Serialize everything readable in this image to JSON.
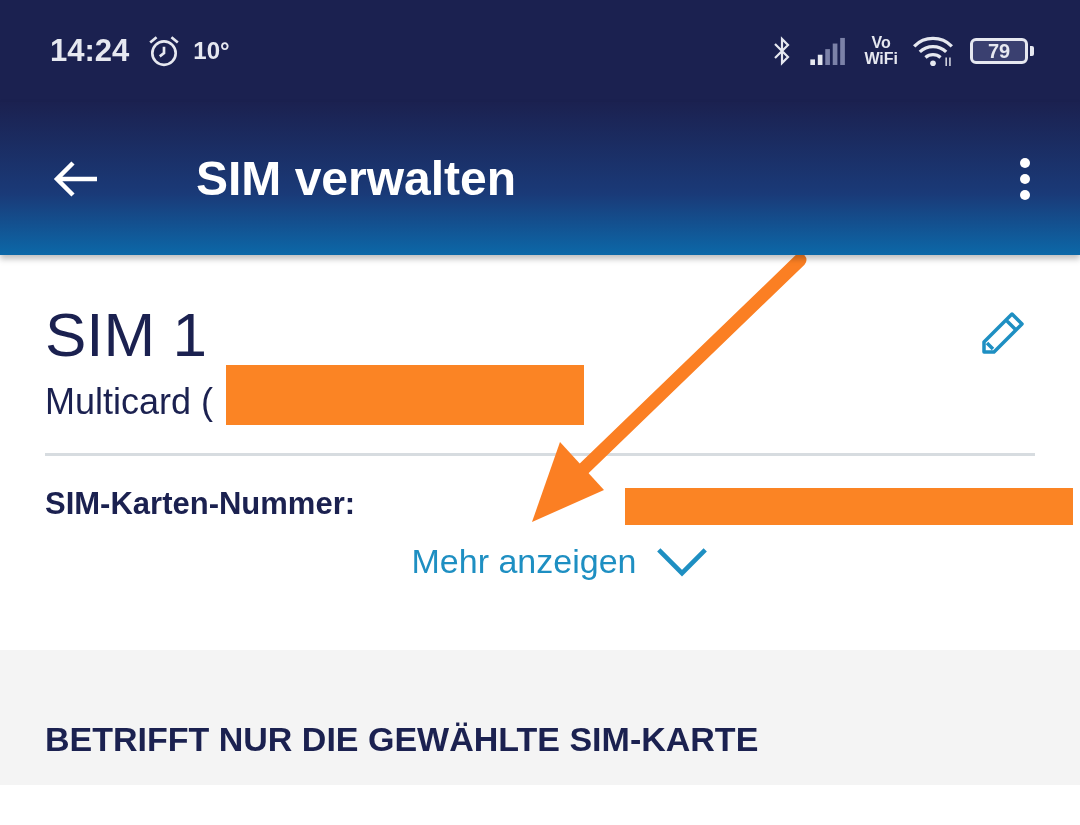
{
  "status_bar": {
    "time": "14:24",
    "temperature": "10°",
    "network_label_top": "Vo",
    "network_label_bottom": "WiFi",
    "battery": "79"
  },
  "app_bar": {
    "title": "SIM verwalten"
  },
  "sim_card": {
    "name": "SIM 1",
    "provider": "Multicard (",
    "number_label": "SIM-Karten-Nummer:",
    "more_link": "Mehr anzeigen"
  },
  "section": {
    "heading": "BETRIFFT NUR DIE GEWÄHLTE SIM-KARTE"
  }
}
